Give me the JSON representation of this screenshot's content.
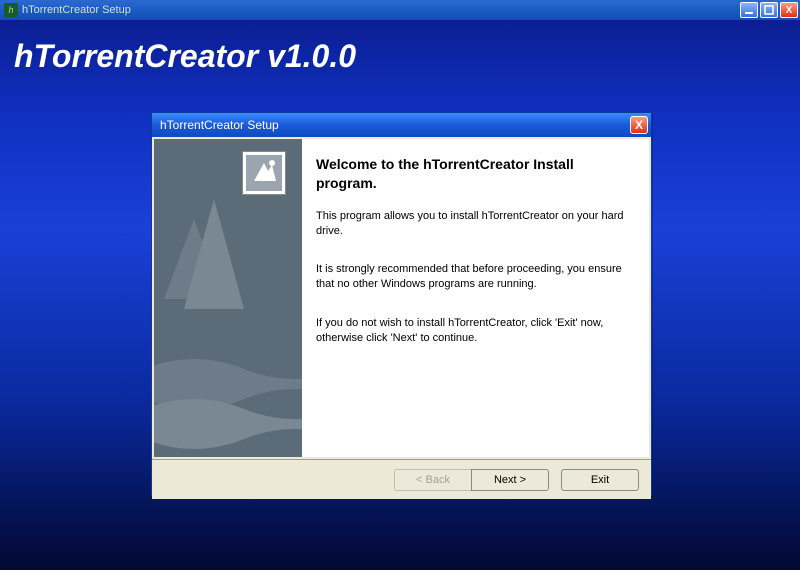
{
  "outer_window": {
    "title": "hTorrentCreator Setup",
    "banner": "hTorrentCreator v1.0.0",
    "app_icon_glyph": "h",
    "controls": {
      "minimize": "_",
      "maximize": "□",
      "close": "X"
    }
  },
  "installer": {
    "title": "hTorrentCreator Setup",
    "close_glyph": "X",
    "heading": "Welcome to the hTorrentCreator Install program.",
    "paragraph1": "This program allows you to install hTorrentCreator on your hard drive.",
    "paragraph2": "It is strongly recommended that before proceeding, you ensure that no other Windows programs are running.",
    "paragraph3": "If you do not wish to install hTorrentCreator, click 'Exit' now, otherwise click 'Next' to continue.",
    "buttons": {
      "back": "< Back",
      "next": "Next >",
      "exit": "Exit"
    }
  }
}
